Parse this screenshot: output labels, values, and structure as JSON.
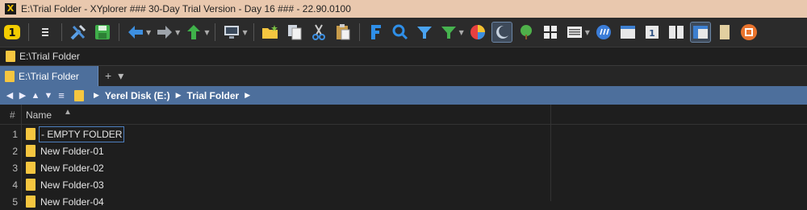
{
  "window": {
    "title": "E:\\Trial Folder - XYplorer ### 30-Day Trial Version - Day 16 ### - 22.90.0100"
  },
  "toolbar": {
    "buttons": [
      "xyplorer-home-icon",
      "menu-icon",
      "settings-icon",
      "save-icon",
      "back-icon",
      "forward-icon",
      "up-icon",
      "computer-icon",
      "new-folder-icon",
      "copy-icon",
      "cut-icon",
      "paste-icon",
      "find-files-icon",
      "search-icon",
      "filter-icon",
      "visual-filter-icon",
      "color-filter-icon",
      "dark-mode-icon",
      "tree-icon",
      "views-icon",
      "list-view-icon",
      "settings-gear-icon",
      "panel-icon",
      "single-pane-icon",
      "dual-pane-icon",
      "layout-icon",
      "bookmark-icon",
      "info-panel-icon"
    ]
  },
  "address": {
    "path": "E:\\Trial Folder"
  },
  "tabs": [
    {
      "label": "E:\\Trial Folder",
      "active": true
    }
  ],
  "tab_controls": {
    "add": "+",
    "menu": "▾"
  },
  "breadcrumb": {
    "items": [
      "Yerel Disk (E:)",
      "Trial Folder"
    ]
  },
  "list": {
    "headers": {
      "num": "#",
      "name": "Name"
    },
    "rows": [
      {
        "num": "1",
        "name": "- EMPTY FOLDER"
      },
      {
        "num": "2",
        "name": "New Folder-01"
      },
      {
        "num": "3",
        "name": "New Folder-02"
      },
      {
        "num": "4",
        "name": "New Folder-03"
      },
      {
        "num": "5",
        "name": "New Folder-04"
      }
    ]
  },
  "colors": {
    "titlebar": "#e9c8ae",
    "accent": "#4d6f9c",
    "folder": "#f5c640",
    "background": "#1e1e1e"
  }
}
